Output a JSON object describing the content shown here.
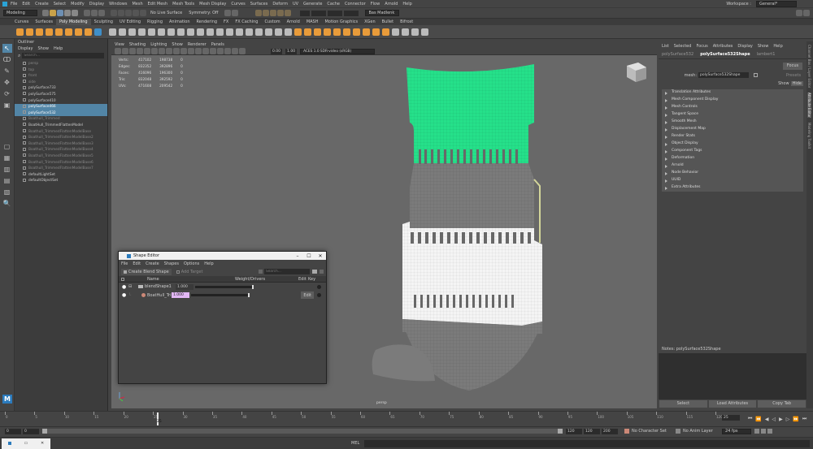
{
  "menu": [
    "File",
    "Edit",
    "Create",
    "Select",
    "Modify",
    "Display",
    "Windows",
    "Mesh",
    "Edit Mesh",
    "Mesh Tools",
    "Mesh Display",
    "Curves",
    "Surfaces",
    "Deform",
    "UV",
    "Generate",
    "Cache",
    "Connector",
    "Flow",
    "Arnold",
    "Help"
  ],
  "workspace_label": "Workspace :",
  "workspace_value": "General*",
  "status": {
    "mode": "Modeling",
    "live_surface": "No Live Surface",
    "symmetry": "Symmetry: Off",
    "user": "Bas Madlenk"
  },
  "shelf_tabs": [
    "Curves",
    "Surfaces",
    "Poly Modeling",
    "Sculpting",
    "UV Editing",
    "Rigging",
    "Animation",
    "Rendering",
    "FX",
    "FX Caching",
    "Custom",
    "Arnold",
    "MASH",
    "Motion Graphics",
    "XGen",
    "Bullet",
    "Bifrost"
  ],
  "outliner": {
    "title": "Outliner",
    "menu": [
      "Display",
      "Show",
      "Help"
    ],
    "search_placeholder": "Search...",
    "items": [
      {
        "label": "persp",
        "state": "dim"
      },
      {
        "label": "top",
        "state": "dim"
      },
      {
        "label": "front",
        "state": "dim"
      },
      {
        "label": "side",
        "state": "dim"
      },
      {
        "label": "polySurface733",
        "state": ""
      },
      {
        "label": "polySurface575",
        "state": ""
      },
      {
        "label": "polySurface410",
        "state": ""
      },
      {
        "label": "polySurface466",
        "state": "sel"
      },
      {
        "label": "polySurface532",
        "state": "sel"
      },
      {
        "label": "Boathull_Trimmed",
        "state": "dim"
      },
      {
        "label": "BoatHull_TrimmedFlattenModel",
        "state": ""
      },
      {
        "label": "Boathull_TrimmedFlattenModelBase",
        "state": "dim"
      },
      {
        "label": "Boathull_TrimmedFlattenModelBase2",
        "state": "dim"
      },
      {
        "label": "Boathull_TrimmedFlattenModelBase3",
        "state": "dim"
      },
      {
        "label": "Boathull_TrimmedFlattenModelBase4",
        "state": "dim"
      },
      {
        "label": "Boathull_TrimmedFlattenModelBase5",
        "state": "dim"
      },
      {
        "label": "Boathull_TrimmedFlattenModelBase6",
        "state": "dim"
      },
      {
        "label": "Boathull_TrimmedFlattenModelBase7",
        "state": "dim"
      },
      {
        "label": "defaultLightSet",
        "state": ""
      },
      {
        "label": "defaultObjectSet",
        "state": ""
      }
    ]
  },
  "viewport": {
    "menu": [
      "View",
      "Shading",
      "Lighting",
      "Show",
      "Renderer",
      "Panels"
    ],
    "colorspace": "ACES 1.0 SDR-video (sRGB)",
    "val1": "0.00",
    "val2": "1.00",
    "camera_label": "persp",
    "hud": [
      [
        "Verts:",
        "417102",
        "198738",
        "0"
      ],
      [
        "Edges:",
        "832352",
        "392896",
        "0"
      ],
      [
        "Faces:",
        "416096",
        "196300",
        "0"
      ],
      [
        "Tris:",
        "832048",
        "392592",
        "0"
      ],
      [
        "UVs:",
        "471608",
        "209542",
        "0"
      ]
    ]
  },
  "attr_editor": {
    "menu": [
      "List",
      "Selected",
      "Focus",
      "Attributes",
      "Display",
      "Show",
      "Help"
    ],
    "tabs": [
      "polySurface532",
      "polySurface532Shape",
      "lambert1"
    ],
    "mesh_label": "mesh:",
    "mesh_value": "polySurface532Shape",
    "focus": "Focus",
    "presets": "Presets",
    "show": "Show",
    "hide": "Hide",
    "sections": [
      "Translation Attributes",
      "Mesh Component Display",
      "Mesh Controls",
      "Tangent Space",
      "Smooth Mesh",
      "Displacement Map",
      "Render Stats",
      "Object Display",
      "Component Tags",
      "Deformation",
      "Arnold",
      "Node Behavior",
      "UUID",
      "Extra Attributes"
    ],
    "notes": "Notes:  polySurface532Shape",
    "btn_select": "Select",
    "btn_load": "Load Attributes",
    "btn_copy": "Copy Tab"
  },
  "side_tabs": [
    "Channel Box / Layer Editor",
    "Attribute Editor",
    "Modeling Toolkit"
  ],
  "shape_editor": {
    "title": "Shape Editor",
    "menu": [
      "File",
      "Edit",
      "Create",
      "Shapes",
      "Options",
      "Help"
    ],
    "create_btn": "Create Blend Shape",
    "add_target": "Add Target",
    "search_placeholder": "Search...",
    "headers": {
      "name": "Name",
      "weight": "Weight/Drivers",
      "edit": "Edit",
      "key": "Key"
    },
    "rows": [
      {
        "name": "blendShape1",
        "value": "1.000",
        "weight": 1.0
      },
      {
        "name": "BoatHull_Trimm",
        "value": "1.000",
        "weight": 1.0,
        "edit": "Edit"
      }
    ]
  },
  "timeline": {
    "ticks": [
      "0",
      "5",
      "10",
      "15",
      "20",
      "25",
      "30",
      "35",
      "40",
      "45",
      "50",
      "55",
      "60",
      "65",
      "70",
      "75",
      "80",
      "85",
      "90",
      "95",
      "100",
      "105",
      "110",
      "115",
      "120"
    ],
    "current": "25",
    "frame_field": "25"
  },
  "range": {
    "start": "0",
    "start2": "0",
    "end": "120",
    "end2": "120",
    "end3": "200",
    "char_set": "No Character Set",
    "anim_layer": "No Anim Layer",
    "fps": "24 fps"
  },
  "cmd": {
    "lang": "MEL"
  }
}
